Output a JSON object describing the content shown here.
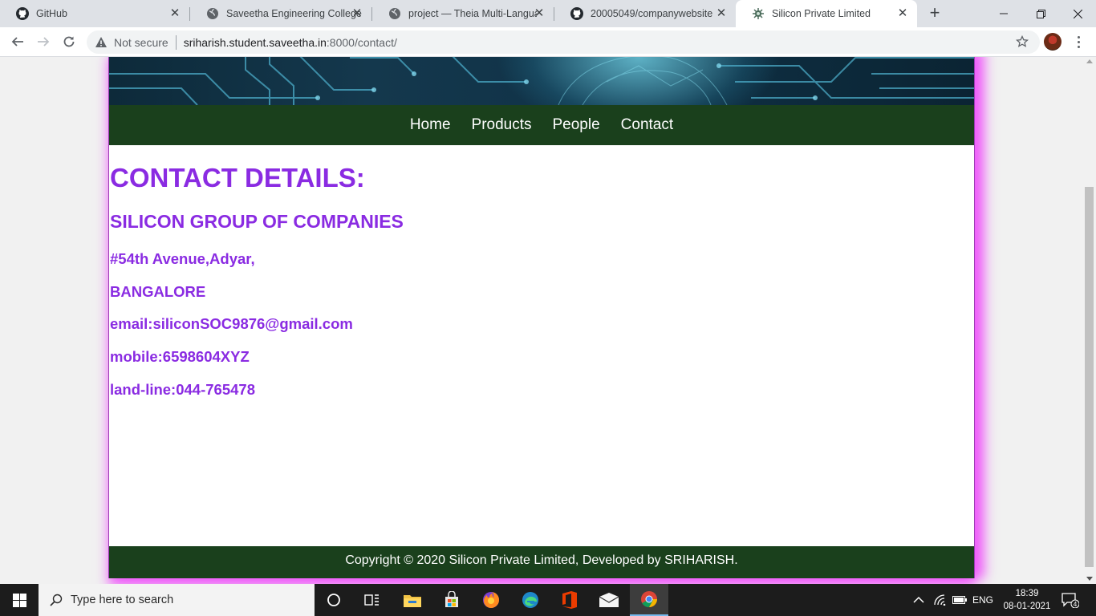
{
  "browser": {
    "tabs": [
      {
        "title": "GitHub",
        "icon": "github-icon"
      },
      {
        "title": "Saveetha Engineering College",
        "icon": "globe-icon"
      },
      {
        "title": "project — Theia Multi-Languag",
        "icon": "globe-icon"
      },
      {
        "title": "20005049/companywebsite",
        "icon": "github-icon"
      },
      {
        "title": "Silicon Private Limited",
        "icon": "site-favicon-icon",
        "active": true
      }
    ],
    "security_label": "Not secure",
    "url_host": "sriharish.student.saveetha.in",
    "url_rest": ":8000/contact/"
  },
  "site": {
    "nav": [
      "Home",
      "Products",
      "People",
      "Contact"
    ],
    "heading": "CONTACT DETAILS:",
    "company": "SILICON GROUP OF COMPANIES",
    "lines": [
      "#54th Avenue,Adyar,",
      "BANGALORE",
      "email:siliconSOC9876@gmail.com",
      "mobile:6598604XYZ",
      "land-line:044-765478"
    ],
    "footer": "Copyright © 2020 Silicon Private Limited, Developed by SRIHARISH.",
    "colors": {
      "accent": "#8a2be2",
      "nav_bg": "#1a401c",
      "glow": "#ee50fa"
    }
  },
  "taskbar": {
    "search_placeholder": "Type here to search",
    "language": "ENG",
    "time": "18:39",
    "date": "08-01-2021",
    "notification_count": "4"
  }
}
